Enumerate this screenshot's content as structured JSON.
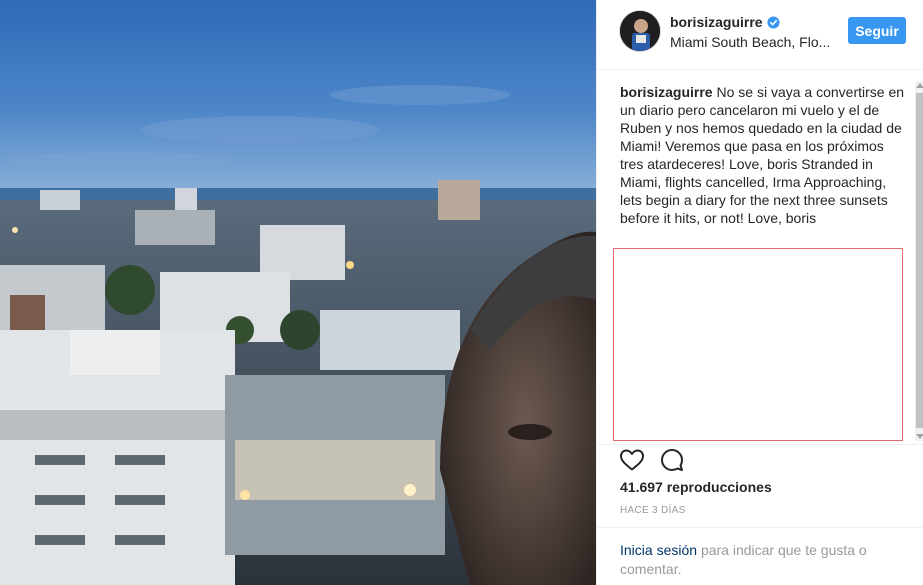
{
  "post": {
    "username": "borisizaguirre",
    "location": "Miami South Beach, Flo...",
    "follow_label": "Seguir",
    "caption_user": "borisizaguirre",
    "caption_text": "No se si vaya a convertirse en un diario pero cancelaron mi vuelo y el de Ruben y nos hemos quedado en la ciudad de Miami! Veremos que pasa en los próximos tres atardeceres! Love, boris Stranded in Miami, flights cancelled, Irma Approaching, lets begin a diary for the next three sunsets before it hits, or not! Love, boris",
    "views": "41.697 reproducciones",
    "time": "HACE 3 DÍAS",
    "login_link": "Inicia sesión",
    "login_rest": "para indicar que te gusta o comentar."
  },
  "icons": {
    "verified": "verified-badge-icon",
    "like": "heart-icon",
    "comment": "comment-bubble-icon"
  },
  "colors": {
    "follow_button": "#3897f0",
    "verified_badge": "#3897f0",
    "link": "#003569",
    "muted_text": "#999999",
    "embed_border": "#e06b6b"
  }
}
